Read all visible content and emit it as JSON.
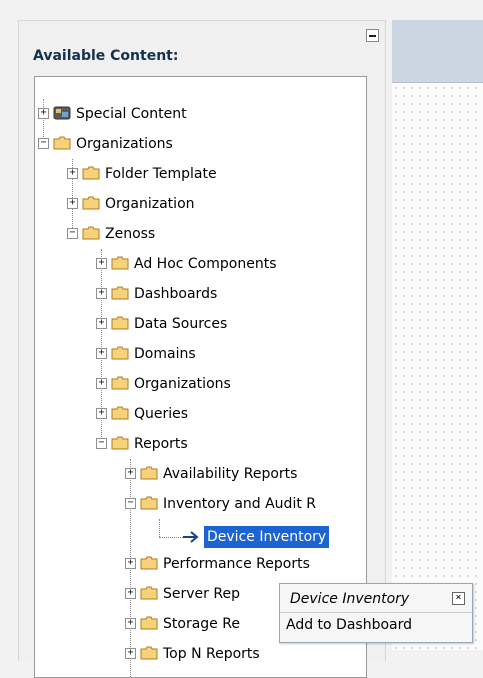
{
  "panel": {
    "title": "Available Content:",
    "collapse_icon": "minus-icon"
  },
  "tree": {
    "nodes": [
      {
        "label": "Special Content",
        "expander": "+",
        "icon": "special-content-icon"
      },
      {
        "label": "Organizations",
        "expander": "−",
        "icon": "folder-icon"
      },
      {
        "label": "Folder Template",
        "expander": "+",
        "icon": "folder-icon"
      },
      {
        "label": "Organization",
        "expander": "+",
        "icon": "folder-icon"
      },
      {
        "label": "Zenoss",
        "expander": "−",
        "icon": "folder-icon"
      },
      {
        "label": "Ad Hoc Components",
        "expander": "+",
        "icon": "folder-icon"
      },
      {
        "label": "Dashboards",
        "expander": "+",
        "icon": "folder-icon"
      },
      {
        "label": "Data Sources",
        "expander": "+",
        "icon": "folder-icon"
      },
      {
        "label": "Domains",
        "expander": "+",
        "icon": "folder-icon"
      },
      {
        "label": "Organizations",
        "expander": "+",
        "icon": "folder-icon"
      },
      {
        "label": "Queries",
        "expander": "+",
        "icon": "folder-icon"
      },
      {
        "label": "Reports",
        "expander": "−",
        "icon": "folder-icon"
      },
      {
        "label": "Availability Reports",
        "expander": "+",
        "icon": "folder-icon"
      },
      {
        "label": "Inventory and Audit R",
        "expander": "−",
        "icon": "folder-icon"
      },
      {
        "label": "Device Inventory",
        "icon": "arrow-right-icon",
        "selected": true
      },
      {
        "label": "Performance Reports",
        "expander": "+",
        "icon": "folder-icon"
      },
      {
        "label": "Server Rep",
        "expander": "+",
        "icon": "folder-icon"
      },
      {
        "label": "Storage Re",
        "expander": "+",
        "icon": "folder-icon"
      },
      {
        "label": "Top N Reports",
        "expander": "+",
        "icon": "folder-icon"
      }
    ]
  },
  "context_menu": {
    "title": "Device Inventory",
    "close_icon": "close-icon",
    "item": "Add to Dashboard"
  },
  "colors": {
    "selection": "#1b64d1",
    "folder_fill": "#f6d37a",
    "folder_stroke": "#b07d1e"
  }
}
